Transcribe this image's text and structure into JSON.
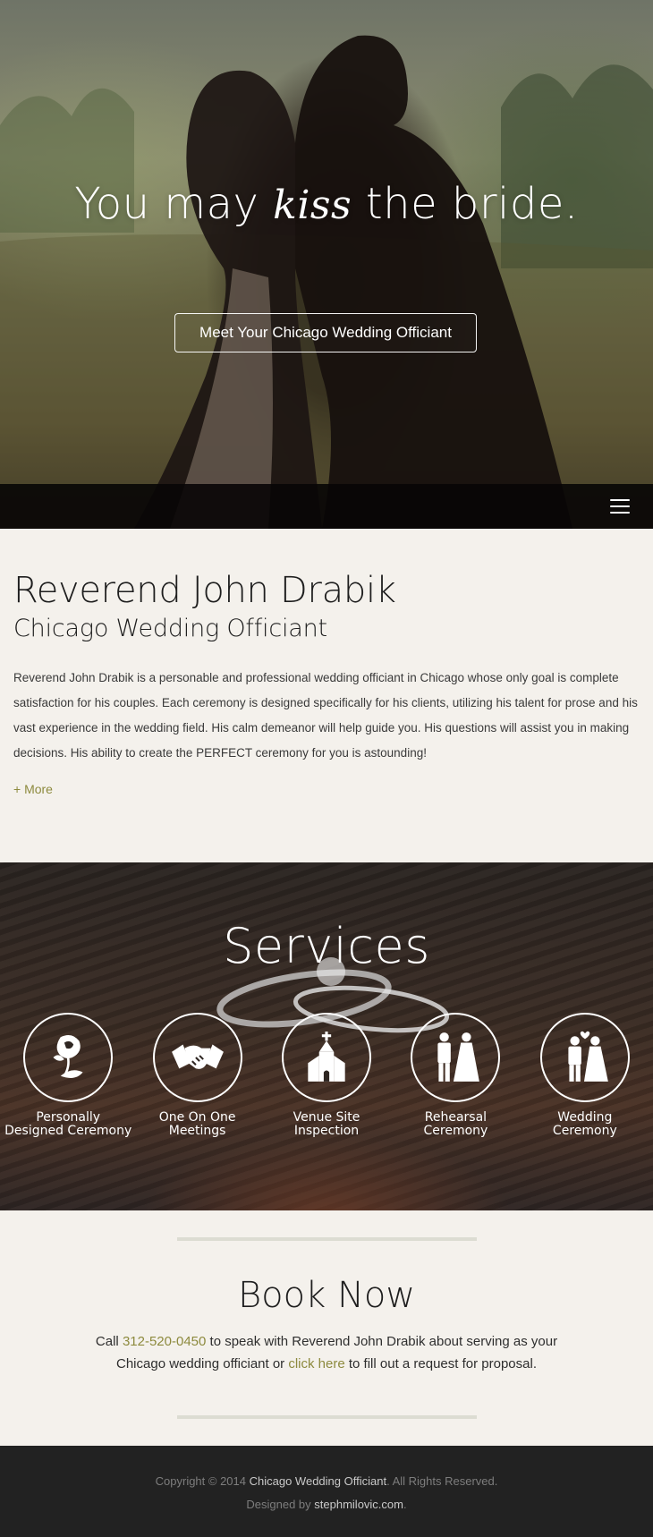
{
  "hero": {
    "title_before": "You may ",
    "title_emphasis": "kiss",
    "title_after": " the bride.",
    "cta_label": "Meet Your Chicago Wedding Officiant",
    "menu_icon": "hamburger-menu-icon"
  },
  "about": {
    "name": "Reverend John Drabik",
    "subtitle": "Chicago Wedding Officiant",
    "body": "Reverend John Drabik is a personable and professional wedding officiant in Chicago whose only goal is complete satisfaction for his couples. Each ceremony is designed specifically for his clients, utilizing his talent for prose and his vast experience in the wedding field. His calm demeanor will help guide you. His questions will assist you in making decisions. His ability to create the PERFECT ceremony for you is astounding!",
    "more_label": "+ More"
  },
  "services": {
    "title": "Services",
    "items": [
      {
        "line1": "Personally",
        "line2": "Designed Ceremony",
        "icon": "rose-icon"
      },
      {
        "line1": "One On One",
        "line2": "Meetings",
        "icon": "handshake-icon"
      },
      {
        "line1": "Venue Site",
        "line2": "Inspection",
        "icon": "chapel-icon"
      },
      {
        "line1": "Rehearsal",
        "line2": "Ceremony",
        "icon": "bride-groom-icon"
      },
      {
        "line1": "Wedding",
        "line2": "Ceremony",
        "icon": "married-couple-icon"
      }
    ]
  },
  "book": {
    "title": "Book Now",
    "text_call": "Call ",
    "phone": "312-520-0450",
    "text_middle": " to speak with Reverend John Drabik about serving as your Chicago wedding officiant or ",
    "click_here": "click here",
    "text_end": " to fill out a request for proposal."
  },
  "footer": {
    "copyright_prefix": "Copyright © 2014 ",
    "site_name": "Chicago Wedding Officiant",
    "rights": ". All Rights Reserved.",
    "designed_by": "Designed by ",
    "designer": "stephmilovic.com",
    "designer_suffix": "."
  },
  "colors": {
    "accent": "#8d8a3e",
    "page_bg": "#f4f1ec",
    "footer_bg": "#222222"
  }
}
